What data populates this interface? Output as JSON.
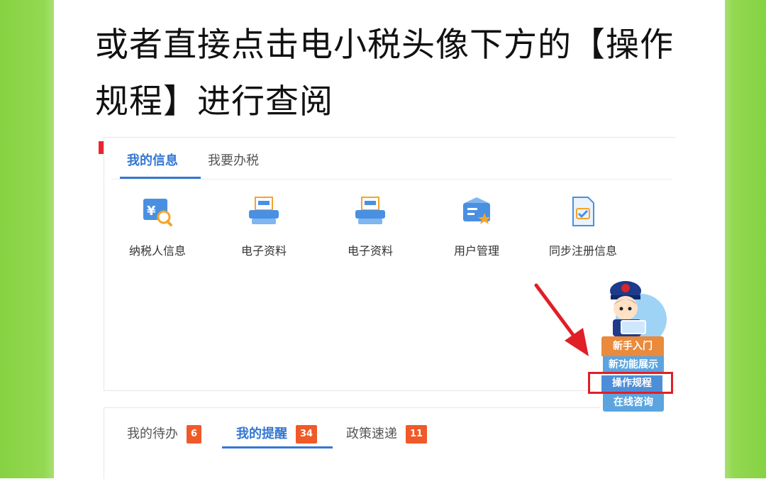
{
  "headline": "或者直接点击电小税头像下方的【操作规程】进行查阅",
  "info_panel": {
    "tabs": [
      {
        "label": "我的信息",
        "active": true
      },
      {
        "label": "我要办税",
        "active": false
      }
    ],
    "tiles": [
      {
        "label": "纳税人信息",
        "icon": "taxpayer-info-icon"
      },
      {
        "label": "电子资料",
        "icon": "printer-icon"
      },
      {
        "label": "电子资料",
        "icon": "printer-icon"
      },
      {
        "label": "用户管理",
        "icon": "user-management-icon"
      },
      {
        "label": "同步注册信息",
        "icon": "sync-registration-icon"
      }
    ]
  },
  "notice_panel": {
    "tabs": [
      {
        "label": "我的待办",
        "count": "6",
        "active": false
      },
      {
        "label": "我的提醒",
        "count": "34",
        "active": true
      },
      {
        "label": "政策速递",
        "count": "11",
        "active": false
      }
    ]
  },
  "assistant_menu": {
    "items": [
      {
        "label": "新手入门"
      },
      {
        "label": "新功能展示"
      },
      {
        "label": "操作规程",
        "highlighted": true
      },
      {
        "label": "在线咨询"
      }
    ]
  },
  "colors": {
    "accent": "#3478d4",
    "badge": "#f05a28",
    "frame_green": "#8bd44a",
    "highlight_red": "#e01f26"
  }
}
